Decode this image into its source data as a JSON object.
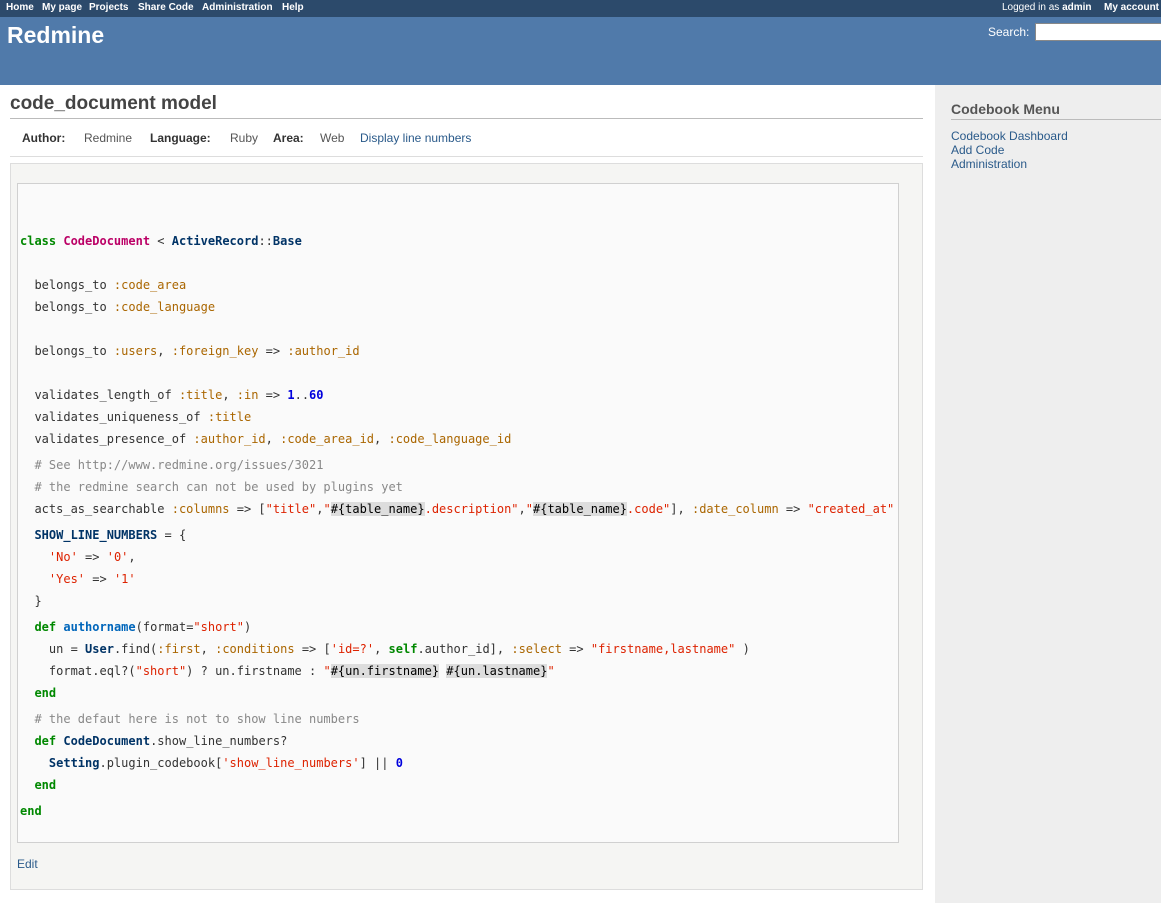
{
  "top_menu": {
    "items": [
      "Home",
      "My page",
      "Projects",
      "Share Code",
      "Administration",
      "Help"
    ],
    "logged_in_prefix": "Logged in as",
    "user": "admin",
    "my_account": "My account"
  },
  "header": {
    "title": "Redmine",
    "search_label": "Search:",
    "search_value": ""
  },
  "sidebar": {
    "heading": "Codebook Menu",
    "links": [
      "Codebook Dashboard",
      "Add Code",
      "Administration"
    ]
  },
  "document": {
    "title": "code_document model",
    "author_label": "Author:",
    "author": "Redmine",
    "language_label": "Language:",
    "language": "Ruby",
    "area_label": "Area:",
    "area": "Web",
    "line_numbers_link": "Display line numbers",
    "edit_link": "Edit"
  },
  "code": {
    "language": "Ruby",
    "lines": [
      "class CodeDocument < ActiveRecord::Base",
      "  belongs_to :code_area",
      "  belongs_to :code_language",
      "  belongs_to :users, :foreign_key => :author_id",
      "  validates_length_of :title, :in => 1..60",
      "  validates_uniqueness_of :title",
      "  validates_presence_of :author_id, :code_area_id, :code_language_id",
      "  # See http://www.redmine.org/issues/3021",
      "  # the redmine search can not be used by plugins yet",
      "  acts_as_searchable :columns => [\"title\",\"#{table_name}.description\",\"#{table_name}.code\"], :date_column => \"created_at\"",
      "  SHOW_LINE_NUMBERS = {",
      "    'No' => '0',",
      "    'Yes' => '1'",
      "  }",
      "  def authorname(format=\"short\")",
      "    un = User.find(:first, :conditions => ['id=?', self.author_id], :select => \"firstname,lastname\" )",
      "    format.eql?(\"short\") ? un.firstname : \"#{un.firstname} #{un.lastname}\"",
      "  end",
      "  # the defaut here is not to show line numbers",
      "  def CodeDocument.show_line_numbers?",
      "    Setting.plugin_codebook['show_line_numbers'] || 0",
      "  end",
      "end"
    ]
  }
}
